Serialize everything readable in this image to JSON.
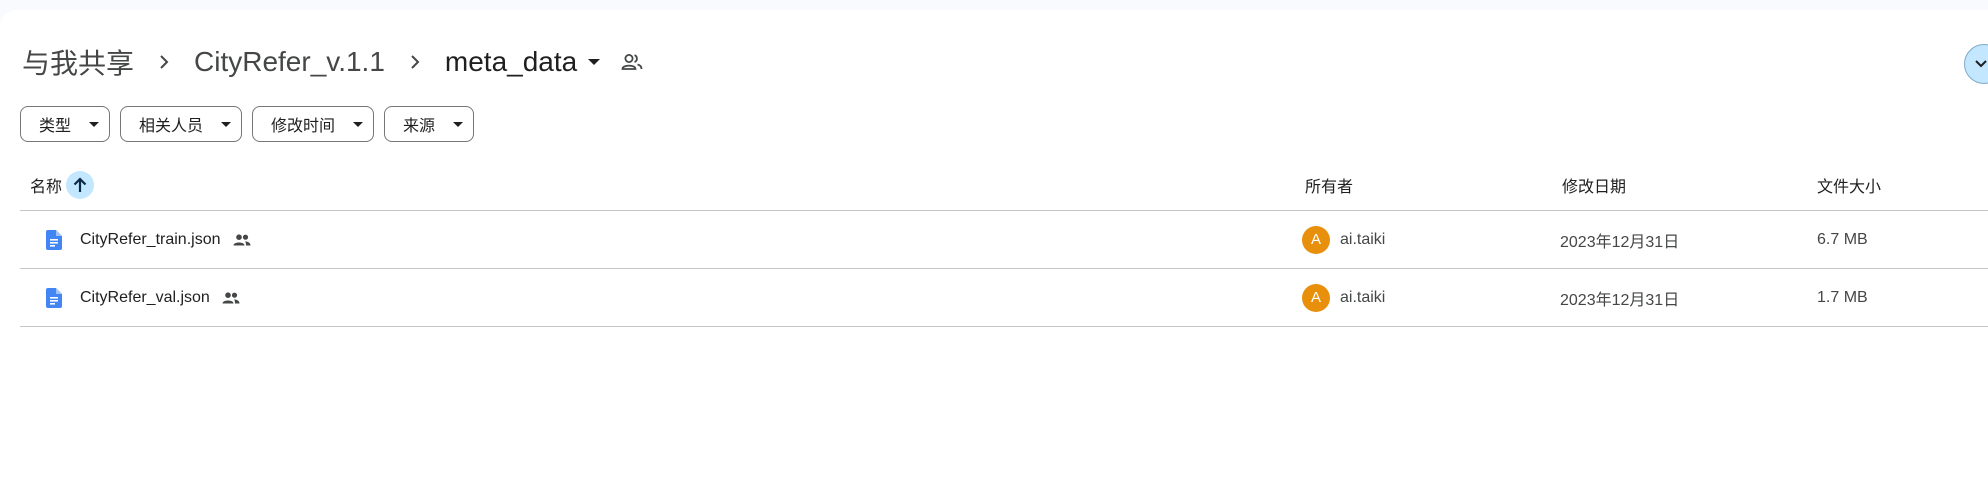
{
  "breadcrumb": {
    "root": "与我共享",
    "parent": "CityRefer_v.1.1",
    "current": "meta_data"
  },
  "filters": [
    {
      "label": "类型"
    },
    {
      "label": "相关人员"
    },
    {
      "label": "修改时间"
    },
    {
      "label": "来源"
    }
  ],
  "table": {
    "headers": {
      "name": "名称",
      "owner": "所有者",
      "modified": "修改日期",
      "size": "文件大小"
    },
    "sort": "ascending",
    "rows": [
      {
        "name": "CityRefer_train.json",
        "owner_initial": "A",
        "owner": "ai.taiki",
        "modified": "2023年12月31日",
        "size": "6.7 MB",
        "shared": true,
        "icon": "doc-icon"
      },
      {
        "name": "CityRefer_val.json",
        "owner_initial": "A",
        "owner": "ai.taiki",
        "modified": "2023年12月31日",
        "size": "1.7 MB",
        "shared": true,
        "icon": "doc-icon"
      }
    ]
  },
  "colors": {
    "doc_icon": "#4285f4",
    "avatar": "#e8900c",
    "sort_button": "#c2e7ff"
  }
}
